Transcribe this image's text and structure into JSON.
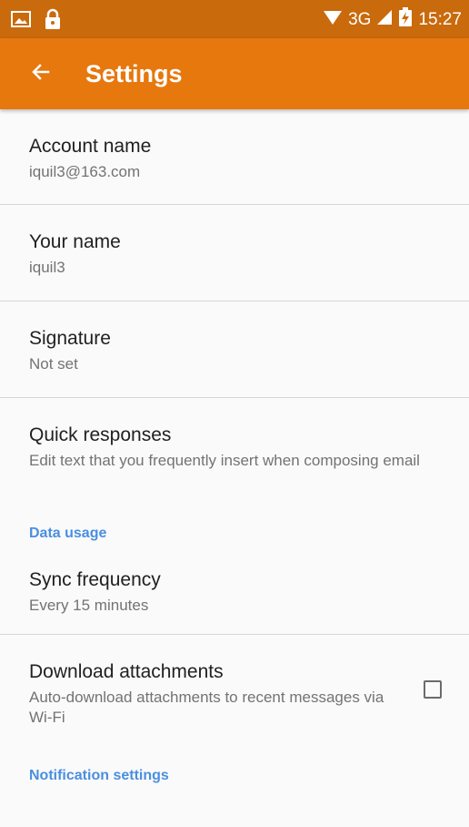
{
  "status_bar": {
    "icons_left": [
      "image-icon",
      "lock-icon"
    ],
    "network": "3G",
    "time": "15:27"
  },
  "toolbar": {
    "back_icon": "arrow-left-icon",
    "title": "Settings"
  },
  "settings": {
    "account_name": {
      "title": "Account name",
      "summary": "iquil3@163.com"
    },
    "your_name": {
      "title": "Your name",
      "summary": "iquil3"
    },
    "signature": {
      "title": "Signature",
      "summary": "Not set"
    },
    "quick_responses": {
      "title": "Quick responses",
      "summary": "Edit text that you frequently insert when composing email"
    },
    "data_usage_header": "Data usage",
    "sync_frequency": {
      "title": "Sync frequency",
      "summary": "Every 15 minutes"
    },
    "download_attachments": {
      "title": "Download attachments",
      "summary": "Auto-download attachments to recent messages via Wi-Fi",
      "checked": false
    },
    "notification_header": "Notification settings"
  },
  "colors": {
    "status_bar": "#c96a0c",
    "toolbar": "#e6780e",
    "category_text": "#4a8fe0",
    "background": "#fafafa"
  }
}
